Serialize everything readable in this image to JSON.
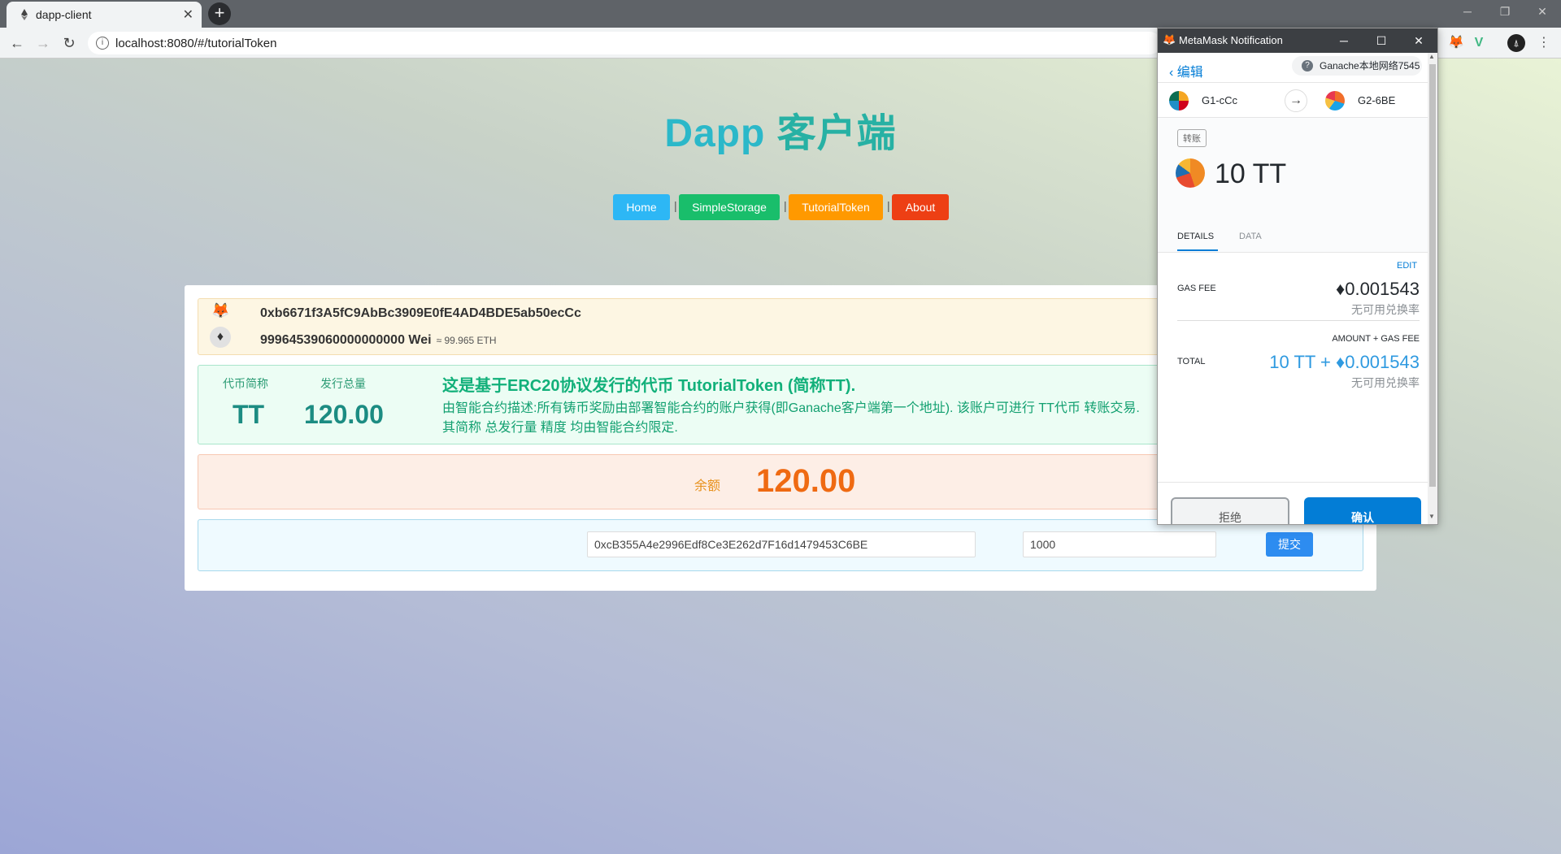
{
  "browser": {
    "tab_title": "dapp-client",
    "url": "localhost:8080/#/tutorialToken",
    "new_tab": "+"
  },
  "app": {
    "title_a": "Dapp",
    "title_b": "客户端",
    "nav": [
      {
        "label": "Home",
        "color": "#2db7f5"
      },
      {
        "label": "SimpleStorage",
        "color": "#19be6b"
      },
      {
        "label": "TutorialToken",
        "color": "#ff9900"
      },
      {
        "label": "About",
        "color": "#ed3f14"
      }
    ],
    "nav_separator": "|"
  },
  "account": {
    "address": "0xb6671f3A5fC9AbBc3909E0fE4AD4BDE5ab50ecCc",
    "balance_wei": "99964539060000000000 Wei",
    "balance_eth": "≈ 99.965 ETH"
  },
  "token": {
    "symbol_label": "代币简称",
    "supply_label": "发行总量",
    "symbol": "TT",
    "supply": "120.00",
    "heading": "这是基于ERC20协议发行的代币 TutorialToken (简称TT).",
    "desc_line1": "由智能合约描述:所有铸币奖励由部署智能合约的账户获得(即Ganache客户端第一个地址). 该账户可进行 TT代币 转账交易.",
    "desc_line2": "其简称 总发行量 精度 均由智能合约限定."
  },
  "balance": {
    "label": "余额",
    "value": "120.00"
  },
  "transfer": {
    "to_address": "0xcB355A4e2996Edf8Ce3E262d7F16d1479453C6BE",
    "amount": "1000",
    "submit_label": "提交"
  },
  "metamask": {
    "window_title": "MetaMask Notification",
    "back_label": "编辑",
    "network": "Ganache本地网络7545",
    "from_account": "G1-cCc",
    "to_account": "G2-6BE",
    "tx_type": "转账",
    "amount": "10 TT",
    "tabs": [
      "DETAILS",
      "DATA"
    ],
    "active_tab": "DETAILS",
    "edit_label": "EDIT",
    "gas_fee_label": "GAS FEE",
    "gas_fee_value": "♦0.001543",
    "no_rate": "无可用兑换率",
    "amount_gas_label": "AMOUNT + GAS FEE",
    "total_label": "TOTAL",
    "total_value": "10 TT + ♦0.001543",
    "reject_label": "拒绝",
    "confirm_label": "确认"
  }
}
